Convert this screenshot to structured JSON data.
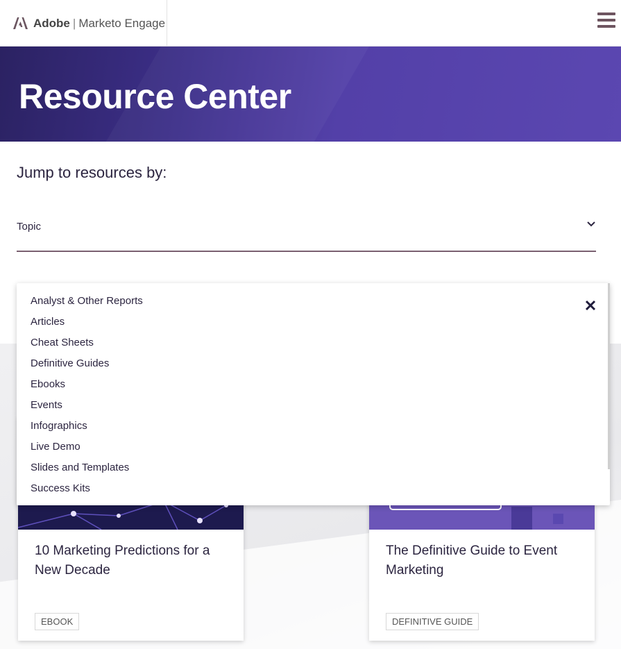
{
  "header": {
    "brand_adobe": "Adobe",
    "brand_separator": "|",
    "brand_product": "Marketo Engage",
    "menu_icon": "hamburger-menu-icon"
  },
  "hero": {
    "title": "Resource Center"
  },
  "jump": {
    "label": "Jump to resources by:",
    "topic_value": "Topic"
  },
  "dropdown": {
    "items": [
      "Analyst & Other Reports",
      "Articles",
      "Cheat Sheets",
      "Definitive Guides",
      "Ebooks",
      "Events",
      "Infographics",
      "Live Demo",
      "Slides and Templates",
      "Success Kits"
    ],
    "close_icon": "close-icon"
  },
  "cards": [
    {
      "title": "10 Marketing Predictions for a New Decade",
      "tag": "EBOOK"
    },
    {
      "title": "The Definitive Guide to Event Marketing",
      "tag": "DEFINITIVE GUIDE"
    }
  ],
  "colors": {
    "hero_gradient_start": "#2b2262",
    "hero_gradient_end": "#5b47b1",
    "text_primary": "#2c2540",
    "accent_underline": "#7a6070"
  }
}
